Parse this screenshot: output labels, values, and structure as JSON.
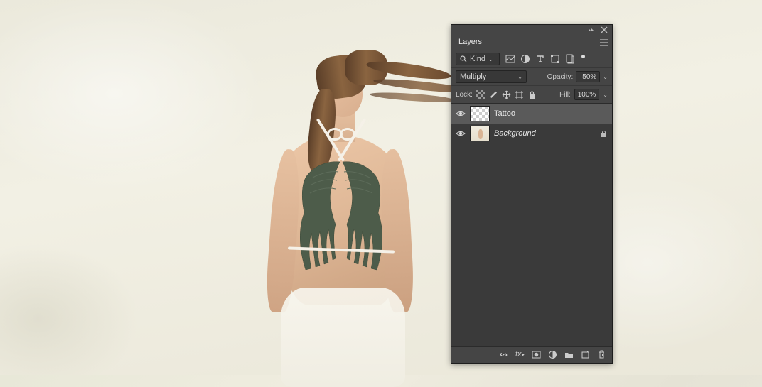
{
  "panel": {
    "title": "Layers",
    "filter": {
      "label": "Kind",
      "search_icon": "search"
    },
    "blend_mode": "Multiply",
    "opacity": {
      "label": "Opacity:",
      "value": "50%"
    },
    "lock": {
      "label": "Lock:"
    },
    "fill": {
      "label": "Fill:",
      "value": "100%"
    },
    "layers": [
      {
        "name": "Tattoo",
        "visible": true,
        "selected": true,
        "locked": false,
        "italic": false,
        "thumb": "transparent"
      },
      {
        "name": "Background",
        "visible": true,
        "selected": false,
        "locked": true,
        "italic": true,
        "thumb": "bg"
      }
    ]
  }
}
